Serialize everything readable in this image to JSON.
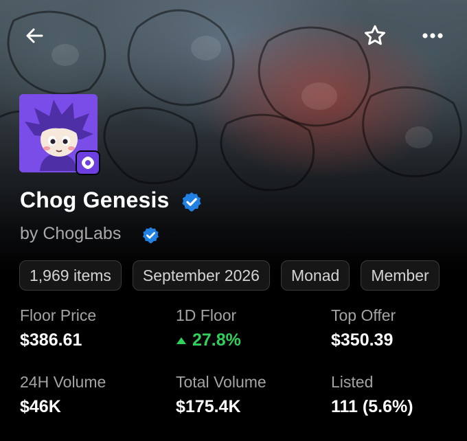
{
  "header": {
    "back_icon": "arrow-left-icon",
    "favorite_icon": "star-outline-icon",
    "more_icon": "more-horizontal-icon"
  },
  "collection": {
    "name": "Chog Genesis",
    "creator": "by ChogLabs",
    "verified_icon": "verified-badge-icon",
    "chain_icon": "monad-chain-icon",
    "accent_color": "#7b4de8",
    "verified_color": "#2081e2"
  },
  "chips": [
    {
      "label": "1,969 items"
    },
    {
      "label": "September 2026"
    },
    {
      "label": "Monad"
    },
    {
      "label": "Member"
    }
  ],
  "stats": {
    "floor_price": {
      "label": "Floor Price",
      "value": "$386.61"
    },
    "one_day_floor": {
      "label": "1D Floor",
      "value": "27.8%",
      "trend": "up",
      "trend_color": "#2fd15a"
    },
    "top_offer": {
      "label": "Top Offer",
      "value": "$350.39"
    },
    "volume_24h": {
      "label": "24H Volume",
      "value": "$46K"
    },
    "total_volume": {
      "label": "Total Volume",
      "value": "$175.4K"
    },
    "listed": {
      "label": "Listed",
      "value": "111 (5.6%)"
    }
  }
}
